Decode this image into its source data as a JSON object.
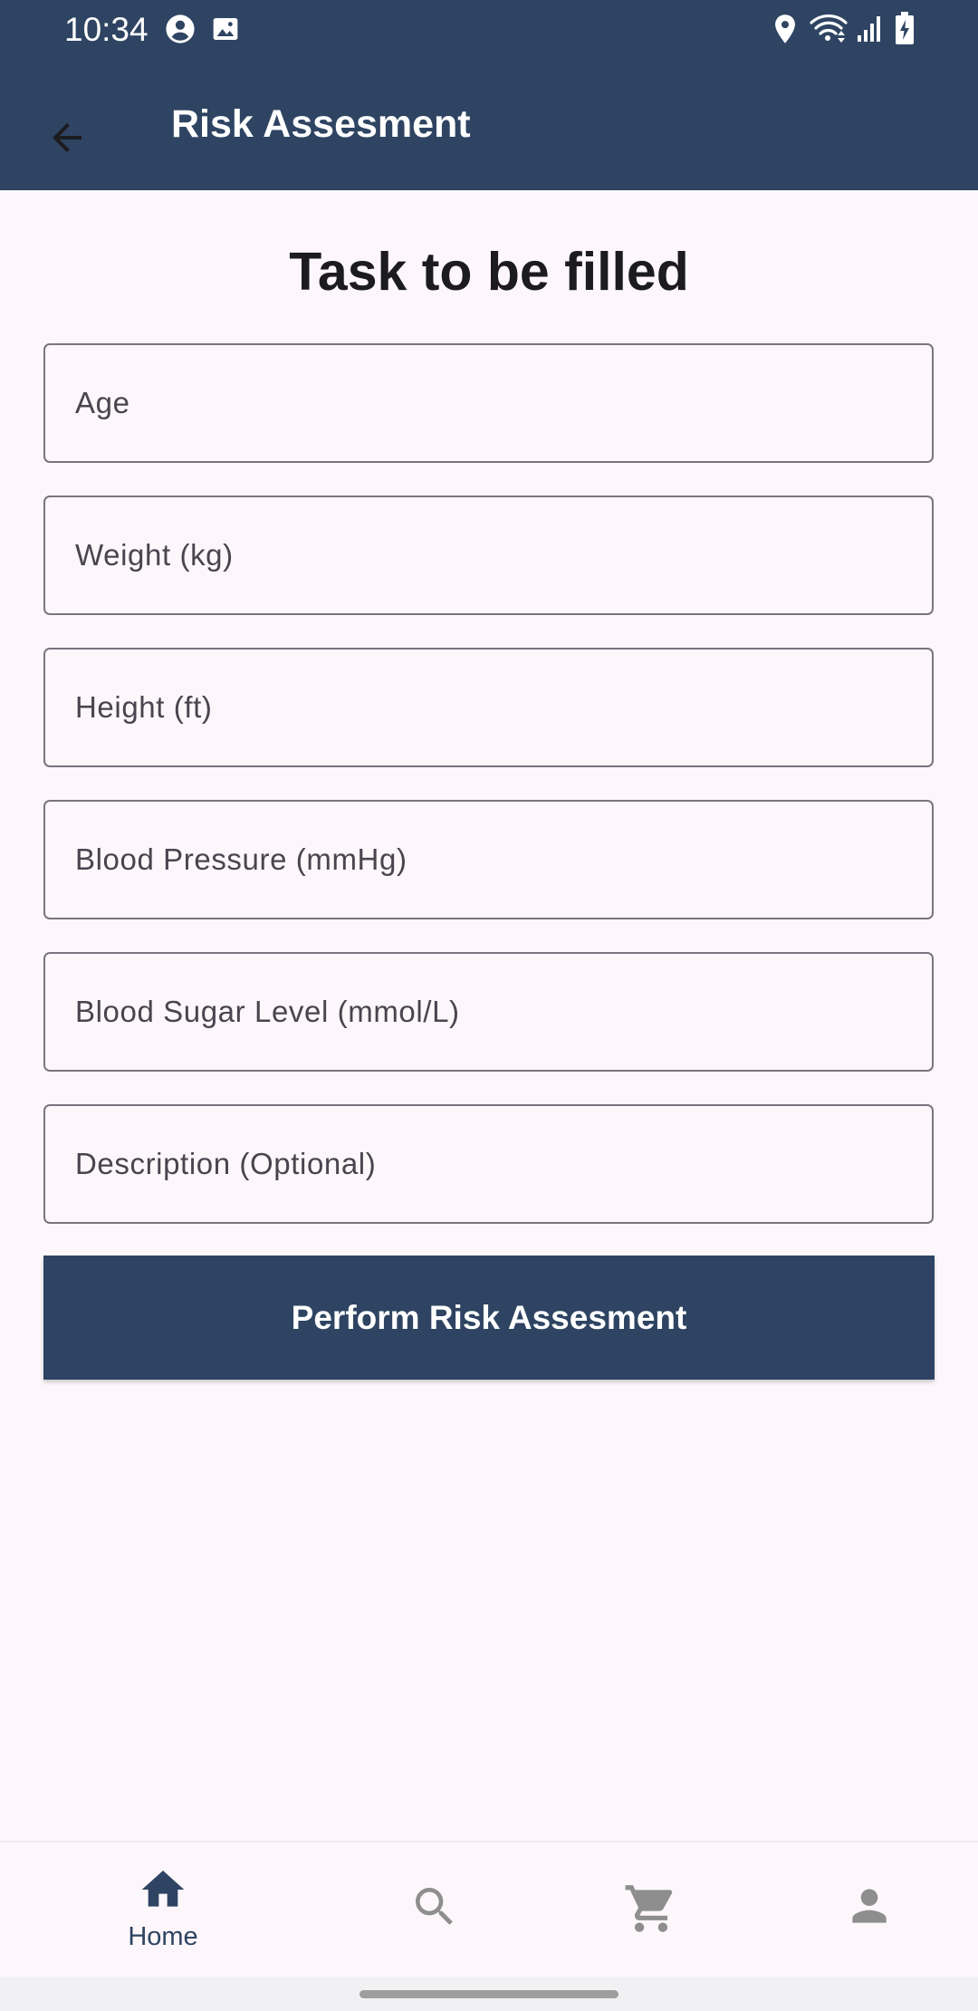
{
  "status_bar": {
    "time": "10:34",
    "left_icons": [
      "account-circle-icon",
      "image-icon"
    ],
    "right_icons": [
      "location-icon",
      "wifi-icon",
      "signal-icon",
      "battery-icon"
    ]
  },
  "app_bar": {
    "back_icon": "arrow-back-icon",
    "title": "Risk Assesment"
  },
  "form": {
    "heading": "Task to be filled",
    "fields": [
      {
        "label": "Age",
        "value": ""
      },
      {
        "label": "Weight (kg)",
        "value": ""
      },
      {
        "label": "Height (ft)",
        "value": ""
      },
      {
        "label": "Blood Pressure (mmHg)",
        "value": ""
      },
      {
        "label": "Blood Sugar Level (mmol/L)",
        "value": ""
      },
      {
        "label": "Description (Optional)",
        "value": ""
      }
    ],
    "submit_label": "Perform Risk Assesment"
  },
  "bottom_nav": {
    "items": [
      {
        "icon": "home-icon",
        "label": "Home",
        "selected": true
      },
      {
        "icon": "search-icon",
        "label": "",
        "selected": false
      },
      {
        "icon": "cart-icon",
        "label": "",
        "selected": false
      },
      {
        "icon": "person-icon",
        "label": "",
        "selected": false
      }
    ]
  },
  "colors": {
    "primary": "#2e4462",
    "background": "#fdf7fb",
    "outline": "#79747e",
    "label_text": "#49454f",
    "inactive_icon": "#8e8e8e"
  }
}
